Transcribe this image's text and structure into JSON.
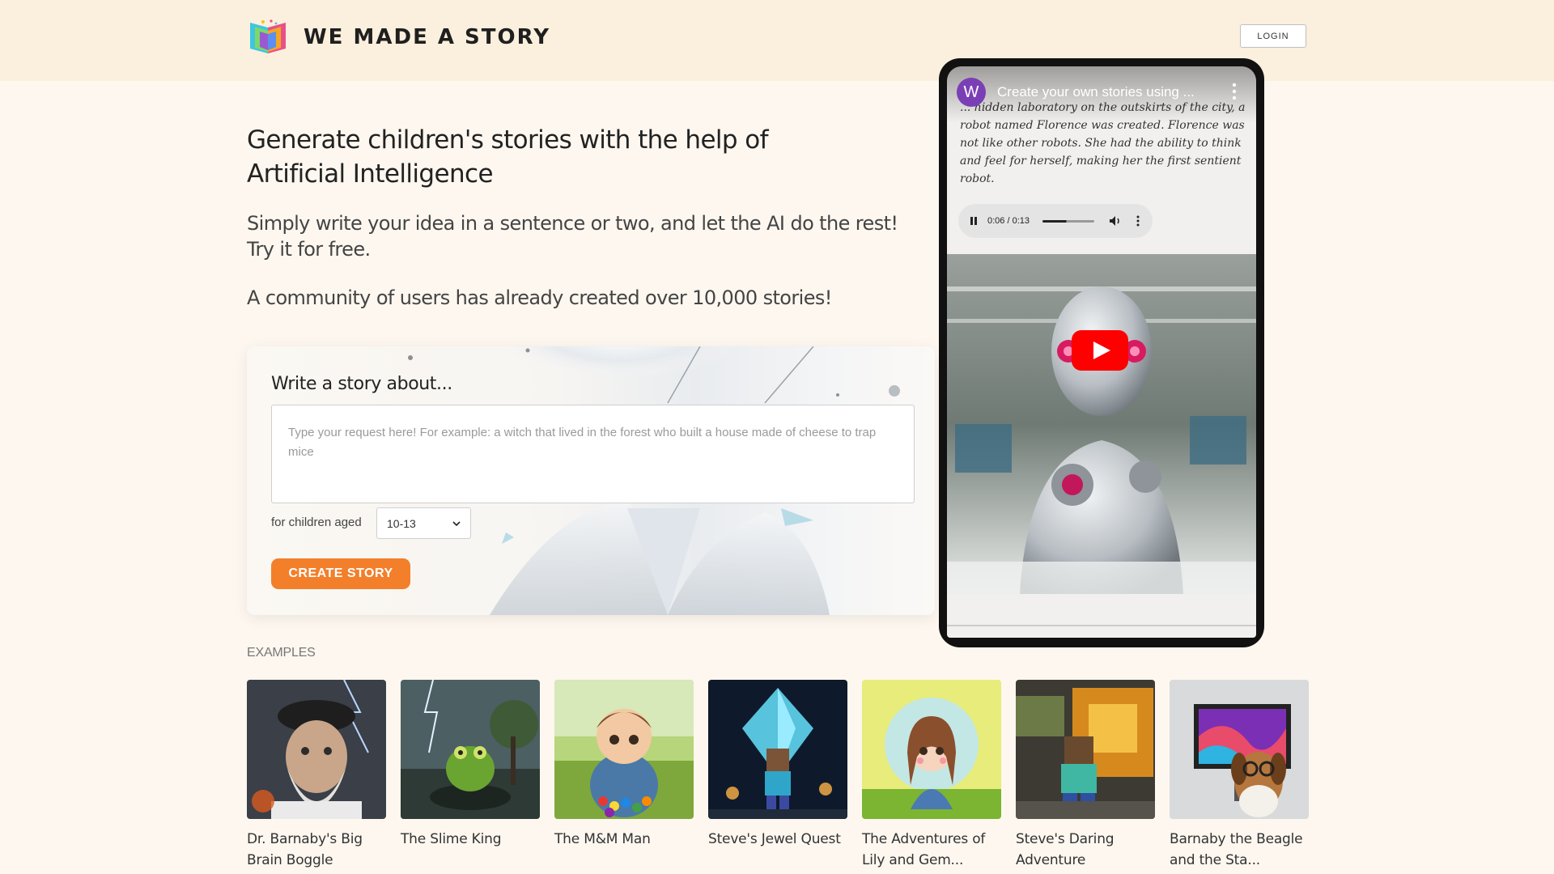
{
  "header": {
    "brand": "WE MADE A STORY",
    "login_label": "LOGIN"
  },
  "hero": {
    "title": "Generate children's stories with the help of Artificial Intelligence",
    "subtitle": "Simply write your idea in a sentence or two, and let the AI do the rest! Try it for free.",
    "community": "A community of users has already created over 10,000 stories!"
  },
  "story_form": {
    "title": "Write a story about...",
    "placeholder": "Type your request here! For example: a witch that lived in the forest who built a house made of cheese to trap mice",
    "age_label": "for children aged",
    "age_value": "10-13",
    "submit_label": "CREATE STORY"
  },
  "video": {
    "channel_initial": "W",
    "title": "Create your own stories using ...",
    "story_excerpt": "... hidden laboratory on the outskirts of the city, a robot named Florence was created. Florence was not like other robots. She had the ability to think and feel for herself, making her the first sentient robot.",
    "audio_time": "0:06 / 0:13",
    "audio_progress": 0.46
  },
  "examples": {
    "label": "EXAMPLES",
    "items": [
      {
        "title": "Dr. Barnaby's Big Brain Boggle"
      },
      {
        "title": "The Slime King"
      },
      {
        "title": "The M&M Man"
      },
      {
        "title": "Steve's Jewel Quest"
      },
      {
        "title": "The Adventures of Lily and Gem..."
      },
      {
        "title": "Steve's Daring Adventure"
      },
      {
        "title": "Barnaby the Beagle and the Sta..."
      }
    ]
  },
  "colors": {
    "header_bg": "#fbefdd",
    "page_bg": "#fdf7ef",
    "accent": "#f37f2b",
    "youtube_red": "#ff0000"
  }
}
